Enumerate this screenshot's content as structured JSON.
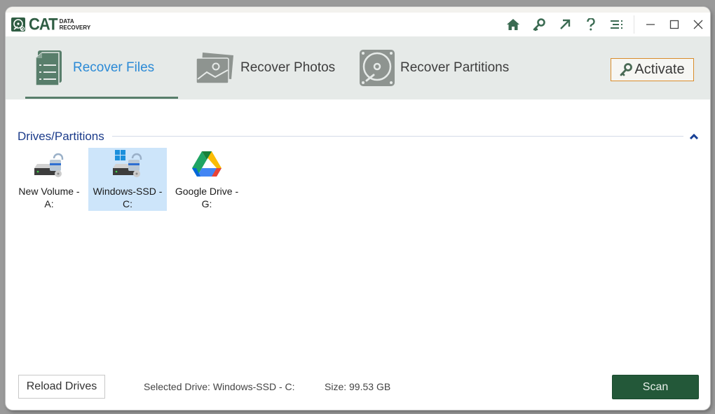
{
  "app": {
    "logo_main": "CAT",
    "logo_sub_line1": "DATA",
    "logo_sub_line2": "RECOVERY"
  },
  "titlebar": {
    "icons": [
      "home-icon",
      "key-icon",
      "external-link-icon",
      "help-icon",
      "menu-icon"
    ],
    "window_controls": [
      "minimize",
      "maximize",
      "close"
    ]
  },
  "tabs": [
    {
      "label": "Recover Files",
      "icon": "document-list-icon",
      "active": true
    },
    {
      "label": "Recover Photos",
      "icon": "photos-icon",
      "active": false
    },
    {
      "label": "Recover Partitions",
      "icon": "hard-disk-icon",
      "active": false
    }
  ],
  "activate": {
    "label": "Activate",
    "icon": "key-icon"
  },
  "drives_section": {
    "title": "Drives/Partitions",
    "drives": [
      {
        "name_line1": "New Volume -",
        "name_line2": "A:",
        "icon": "locked-drive-icon",
        "selected": false
      },
      {
        "name_line1": "Windows-SSD -",
        "name_line2": "C:",
        "icon": "windows-locked-drive-icon",
        "selected": true
      },
      {
        "name_line1": "Google Drive -",
        "name_line2": "G:",
        "icon": "google-drive-icon",
        "selected": false
      }
    ]
  },
  "footer": {
    "reload_label": "Reload Drives",
    "selected_drive": "Selected Drive: Windows-SSD - C:",
    "size": "Size: 99.53 GB",
    "scan_label": "Scan"
  },
  "colors": {
    "brand_green": "#235839",
    "active_tab_text": "#2b8ad6",
    "activate_border": "#d98c2b",
    "section_title": "#1b3b8a",
    "selection_bg": "#cde5fa"
  }
}
